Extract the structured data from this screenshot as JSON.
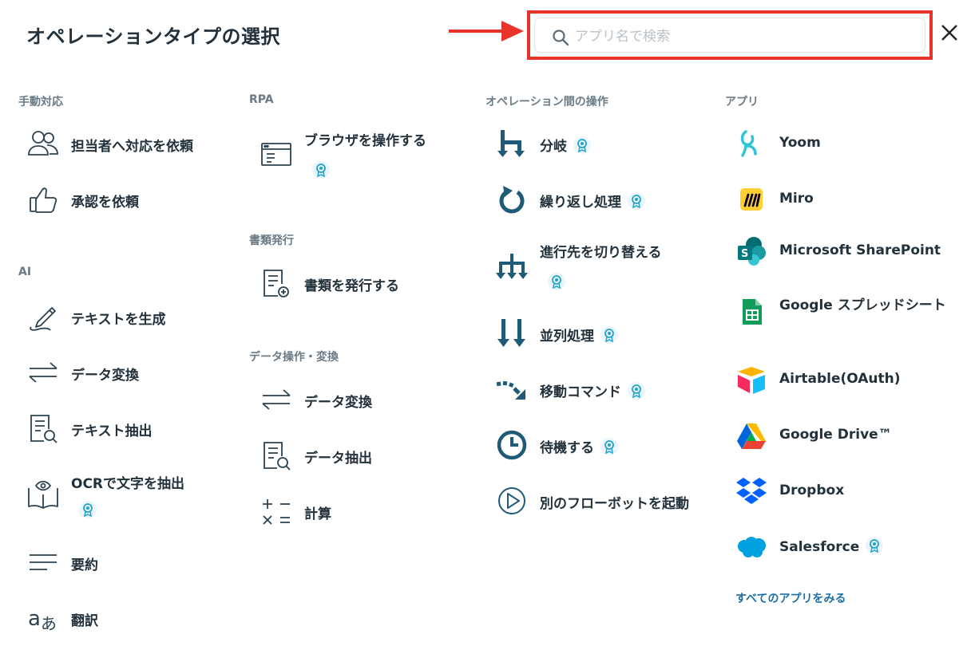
{
  "title": "オペレーションタイプの選択",
  "search": {
    "placeholder": "アプリ名で検索",
    "value": ""
  },
  "colors": {
    "accent": "#1a6fa5",
    "highlight": "#e8332a",
    "badge": "#23a3c9",
    "icon_line": "#2b4250"
  },
  "columns": [
    {
      "sections": [
        {
          "label": "手動対応",
          "items": [
            {
              "label": "担当者へ対応を依頼",
              "icon": "users-icon"
            },
            {
              "label": "承認を依頼",
              "icon": "thumbs-up-icon"
            }
          ]
        },
        {
          "label": "AI",
          "items": [
            {
              "label": "テキストを生成",
              "icon": "pen-icon"
            },
            {
              "label": "データ変換",
              "icon": "swap-arrows-icon"
            },
            {
              "label": "テキスト抽出",
              "icon": "document-search-icon"
            },
            {
              "label": "OCRで文字を抽出",
              "icon": "book-eye-icon",
              "badge": true
            },
            {
              "label": "要約",
              "icon": "lines-icon"
            },
            {
              "label": "翻訳",
              "icon": "translate-icon"
            }
          ]
        }
      ]
    },
    {
      "sections": [
        {
          "label": "RPA",
          "items": [
            {
              "label": "ブラウザを操作する",
              "icon": "browser-icon",
              "badge": true
            }
          ]
        },
        {
          "label": "書類発行",
          "items": [
            {
              "label": "書類を発行する",
              "icon": "document-add-icon"
            }
          ]
        },
        {
          "label": "データ操作・変換",
          "items": [
            {
              "label": "データ変換",
              "icon": "swap-arrows-icon"
            },
            {
              "label": "データ抽出",
              "icon": "document-search-icon"
            },
            {
              "label": "計算",
              "icon": "calculator-icon"
            }
          ]
        }
      ]
    },
    {
      "sections": [
        {
          "label": "オペレーション間の操作",
          "items": [
            {
              "label": "分岐",
              "icon": "branch-icon",
              "badge": true
            },
            {
              "label": "繰り返し処理",
              "icon": "loop-icon",
              "badge": true
            },
            {
              "label": "進行先を切り替える",
              "icon": "switch-route-icon",
              "badge": true
            },
            {
              "label": "並列処理",
              "icon": "parallel-icon",
              "badge": true
            },
            {
              "label": "移動コマンド",
              "icon": "move-command-icon",
              "badge": true
            },
            {
              "label": "待機する",
              "icon": "clock-icon",
              "badge": true
            },
            {
              "label": "別のフローボットを起動",
              "icon": "play-icon"
            }
          ]
        }
      ]
    },
    {
      "sections": [
        {
          "label": "アプリ",
          "items": [
            {
              "label": "Yoom",
              "icon": "yoom-logo-icon"
            },
            {
              "label": "Miro",
              "icon": "miro-logo-icon"
            },
            {
              "label": "Microsoft SharePoint",
              "icon": "sharepoint-logo-icon"
            },
            {
              "label": "Google スプレッドシート",
              "icon": "google-sheets-logo-icon"
            },
            {
              "label": "Airtable(OAuth)",
              "icon": "airtable-logo-icon"
            },
            {
              "label": "Google Drive™",
              "icon": "google-drive-logo-icon"
            },
            {
              "label": "Dropbox",
              "icon": "dropbox-logo-icon"
            },
            {
              "label": "Salesforce",
              "icon": "salesforce-logo-icon",
              "badge": true
            }
          ]
        }
      ]
    }
  ],
  "see_all": "すべてのアプリをみる"
}
